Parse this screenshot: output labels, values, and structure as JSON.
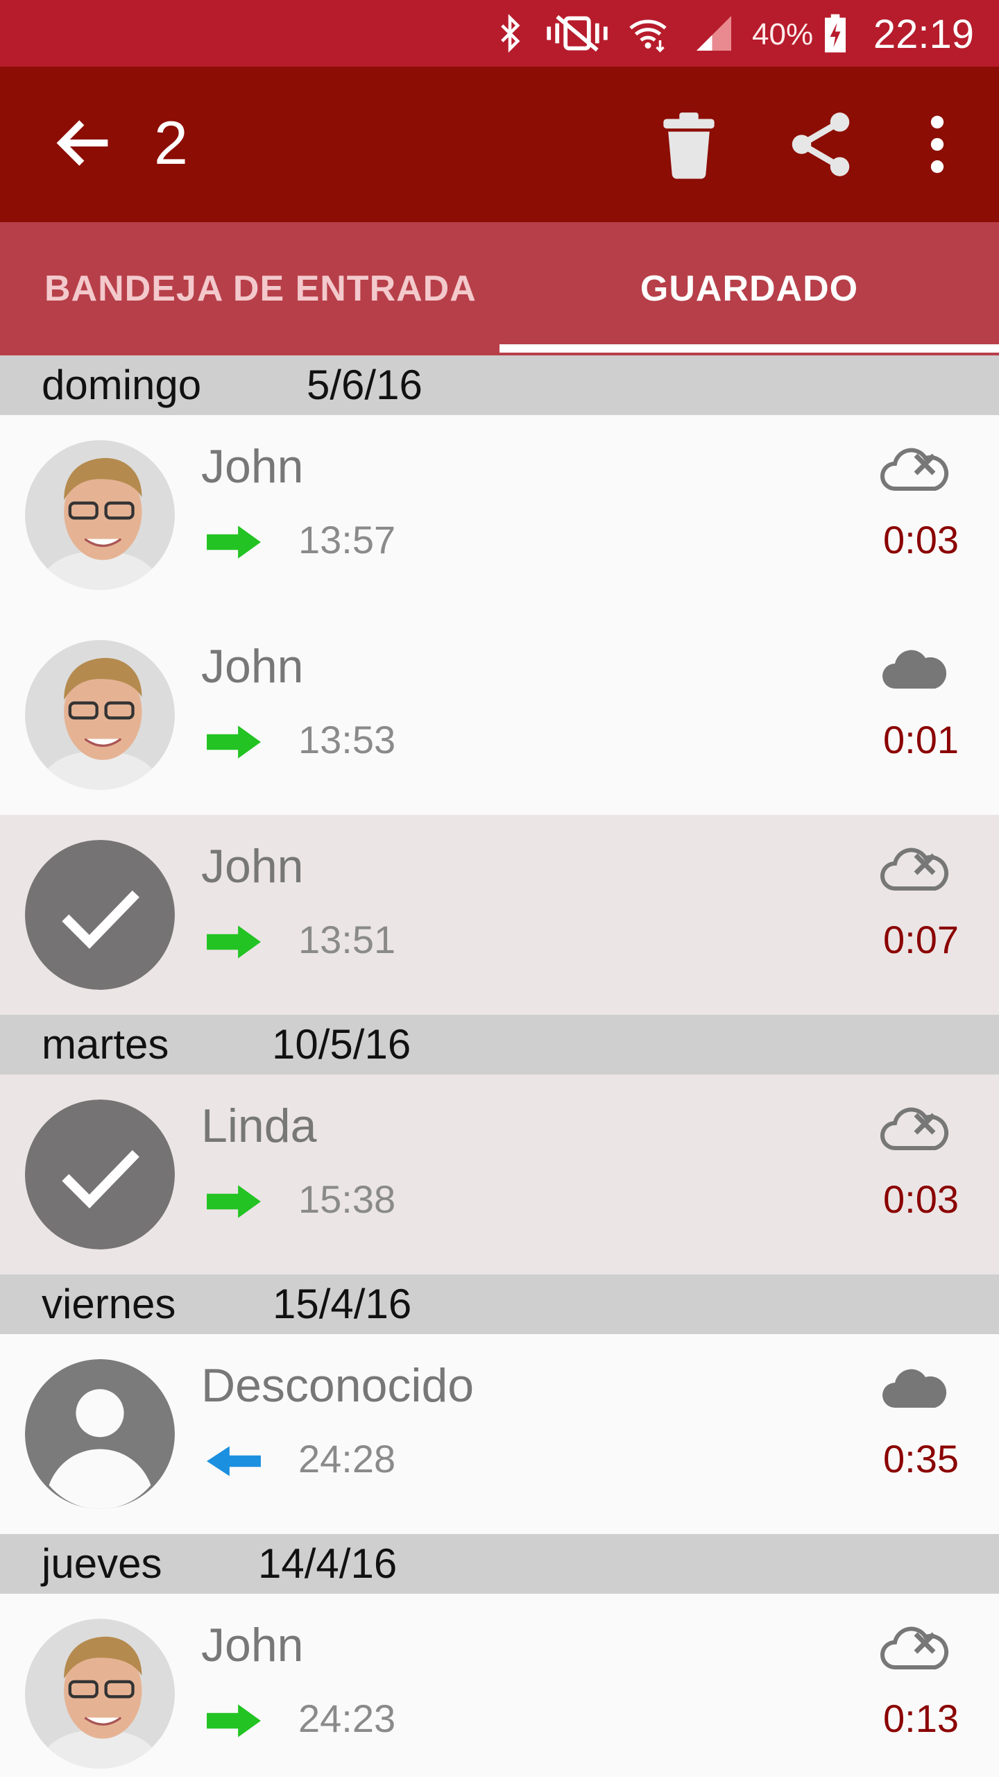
{
  "status_bar": {
    "icons": [
      "bluetooth-icon",
      "vibrate-icon",
      "wifi-icon",
      "signal-icon",
      "battery-charging-icon"
    ],
    "battery": "40%",
    "clock": "22:19"
  },
  "toolbar": {
    "back_icon": "arrow-back-icon",
    "selected_count": "2",
    "actions": [
      "trash-icon",
      "share-icon",
      "more-vert-icon"
    ]
  },
  "tabs": [
    {
      "label": "BANDEJA DE ENTRADA",
      "active": false
    },
    {
      "label": "GUARDADO",
      "active": true
    }
  ],
  "colors": {
    "status_bar": "#b71c2c",
    "toolbar": "#8c0d04",
    "tabs": "#b73f49",
    "outgoing": "#22c322",
    "incoming": "#1b8fe0",
    "duration": "#8b0000"
  },
  "groups": [
    {
      "day": "domingo",
      "date": "5/6/16",
      "calls": [
        {
          "name": "John",
          "direction": "outgoing",
          "time": "13:57",
          "duration": "0:03",
          "cloud": "cloud-off-icon",
          "selected": false,
          "avatar": "photo"
        },
        {
          "name": "John",
          "direction": "outgoing",
          "time": "13:53",
          "duration": "0:01",
          "cloud": "cloud-icon",
          "selected": false,
          "avatar": "photo"
        },
        {
          "name": "John",
          "direction": "outgoing",
          "time": "13:51",
          "duration": "0:07",
          "cloud": "cloud-off-icon",
          "selected": true,
          "avatar": "check"
        }
      ]
    },
    {
      "day": "martes",
      "date": "10/5/16",
      "calls": [
        {
          "name": "Linda",
          "direction": "outgoing",
          "time": "15:38",
          "duration": "0:03",
          "cloud": "cloud-off-icon",
          "selected": true,
          "avatar": "check"
        }
      ]
    },
    {
      "day": "viernes",
      "date": "15/4/16",
      "calls": [
        {
          "name": "Desconocido",
          "direction": "incoming",
          "time": "24:28",
          "duration": "0:35",
          "cloud": "cloud-icon",
          "selected": false,
          "avatar": "person"
        }
      ]
    },
    {
      "day": "jueves",
      "date": "14/4/16",
      "calls": [
        {
          "name": "John",
          "direction": "outgoing",
          "time": "24:23",
          "duration": "0:13",
          "cloud": "cloud-off-icon",
          "selected": false,
          "avatar": "photo"
        }
      ]
    }
  ]
}
